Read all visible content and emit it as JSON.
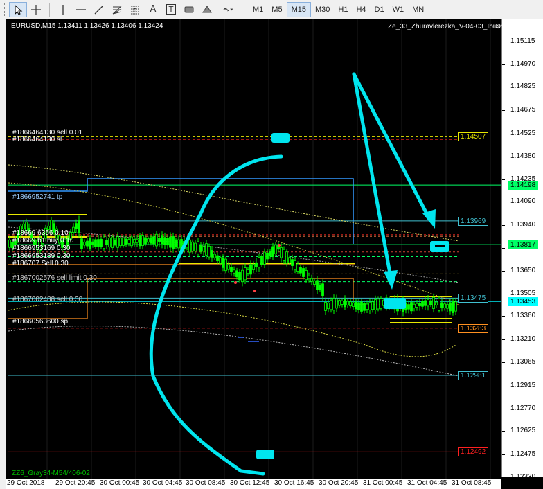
{
  "toolbar": {
    "tools": [
      {
        "name": "cursor-icon"
      },
      {
        "name": "crosshair-icon"
      },
      {
        "name": "vertical-line-icon"
      },
      {
        "name": "horizontal-line-icon"
      },
      {
        "name": "trendline-icon"
      },
      {
        "name": "fibonacci-fan-icon"
      },
      {
        "name": "fibonacci-icon"
      },
      {
        "name": "text-icon"
      },
      {
        "name": "text-label-icon"
      },
      {
        "name": "rectangle-icon"
      },
      {
        "name": "triangle-icon"
      },
      {
        "name": "arrows-icon"
      }
    ],
    "tool_labels": {
      "text": "A",
      "label": "T",
      "fib": "F"
    },
    "timeframes": [
      "M1",
      "M5",
      "M15",
      "M30",
      "H1",
      "H4",
      "D1",
      "W1",
      "MN"
    ],
    "active_timeframe": "M15"
  },
  "chart": {
    "symbol_info": "EURUSD,M15  1.13411 1.13426 1.13406 1.13424",
    "expert_name": "Ze_33_Zhuravlerezka_V-04-03_Ibush",
    "bottom_label": "ZZ6_Gray34-M54/406-02",
    "price_min": 1.1232,
    "price_max": 1.1518,
    "price_ticks": [
      "1.15115",
      "1.14970",
      "1.14825",
      "1.14675",
      "1.14525",
      "1.14380",
      "1.14235",
      "1.14090",
      "1.13940",
      "1.13795",
      "1.13650",
      "1.13505",
      "1.13360",
      "1.13210",
      "1.13065",
      "1.12915",
      "1.12770",
      "1.12625",
      "1.12475",
      "1.12330"
    ],
    "time_labels": [
      "29 Oct 2018",
      "29 Oct 20:45",
      "30 Oct 00:45",
      "30 Oct 04:45",
      "30 Oct 08:45",
      "30 Oct 12:45",
      "30 Oct 16:45",
      "30 Oct 20:45",
      "31 Oct 00:45",
      "31 Oct 04:45",
      "31 Oct 08:45"
    ],
    "order_labels": [
      {
        "text": "#1866464130 sell 0.01",
        "color": "#ffffff"
      },
      {
        "text": "#1866464130 sl",
        "color": "#ffffff"
      },
      {
        "text": "#1866952741 tp",
        "color": "#9fd0ff"
      },
      {
        "text": "#1867002576 sell limit 0.30",
        "color": "#cccccc"
      },
      {
        "text": "#1867002488 sell 0.30",
        "color": "#cccccc"
      },
      {
        "text": "#18660563600 sp",
        "color": "#ffffff"
      }
    ],
    "stacked_labels": [
      "#18669 6356 0.10",
      "#18669 b1 buy 0.10",
      "#1866953169 0.30",
      "#1866953189 0.30",
      "#186707 Sell 0.30"
    ],
    "price_badges": [
      {
        "price": "1.14507",
        "border": "#e8e800",
        "text": "#e8e800",
        "bg": "#000000"
      },
      {
        "price": "1.14198",
        "border": "#00ff66",
        "text": "#000000",
        "bg": "#00ff66"
      },
      {
        "price": "1.13969",
        "border": "#40c0d0",
        "text": "#40c0d0",
        "bg": "#000000"
      },
      {
        "price": "1.13817",
        "border": "#00ff66",
        "text": "#000000",
        "bg": "#00ff66"
      },
      {
        "price": "1.13475",
        "border": "#40c0d0",
        "text": "#40c0d0",
        "bg": "#000000"
      },
      {
        "price": "1.13453",
        "border": "#00ffff",
        "text": "#000000",
        "bg": "#00ffff"
      },
      {
        "price": "1.13283",
        "border": "#ff9020",
        "text": "#ff9020",
        "bg": "#000000"
      },
      {
        "price": "1.12981",
        "border": "#40c0d0",
        "text": "#40c0d0",
        "bg": "#000000"
      },
      {
        "price": "1.12492",
        "border": "#ff2020",
        "text": "#ff2020",
        "bg": "#000000"
      }
    ],
    "colors": {
      "annotation": "#00e5ee",
      "candles": "#00ff00",
      "level_yellow": "#e8e800",
      "level_green": "#00ff66",
      "level_red": "#ff2020",
      "level_orange": "#ff9020",
      "level_cyan": "#40c0d0",
      "tp_line": "#3399ff"
    }
  }
}
